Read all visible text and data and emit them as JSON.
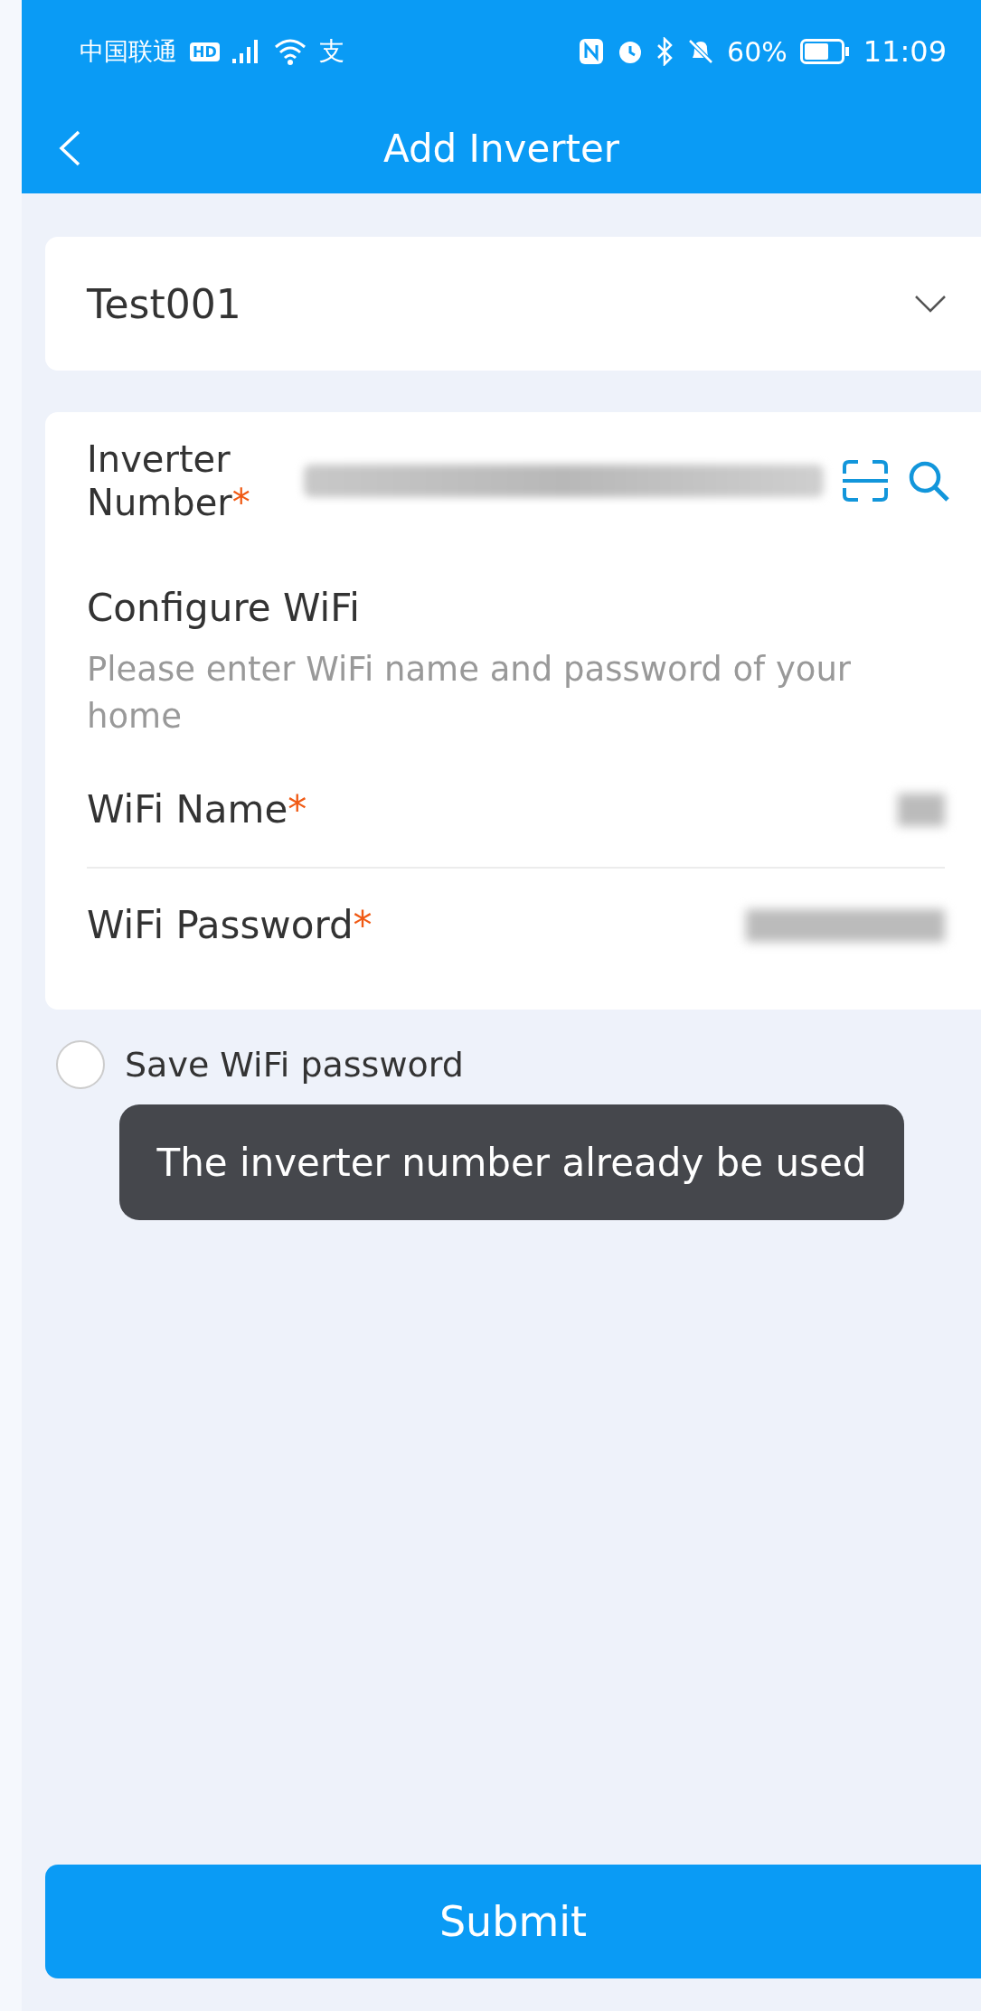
{
  "status_bar": {
    "carrier": "中国联通",
    "hd": "HD",
    "app_glyph": "支",
    "battery": "60%",
    "time": "11:09"
  },
  "header": {
    "title": "Add Inverter"
  },
  "station": {
    "value": "Test001"
  },
  "inverter": {
    "label": "Inverter Number",
    "mark": "*"
  },
  "wifi": {
    "title": "Configure WiFi",
    "hint": "Please enter WiFi name and password of your home",
    "fields": [
      {
        "label": "WiFi Name",
        "mark": "*"
      },
      {
        "label": "WiFi Password",
        "mark": "*"
      }
    ]
  },
  "save_password": {
    "label": "Save WiFi password",
    "checked": false
  },
  "toast": "The inverter number already be used",
  "submit": "Submit"
}
